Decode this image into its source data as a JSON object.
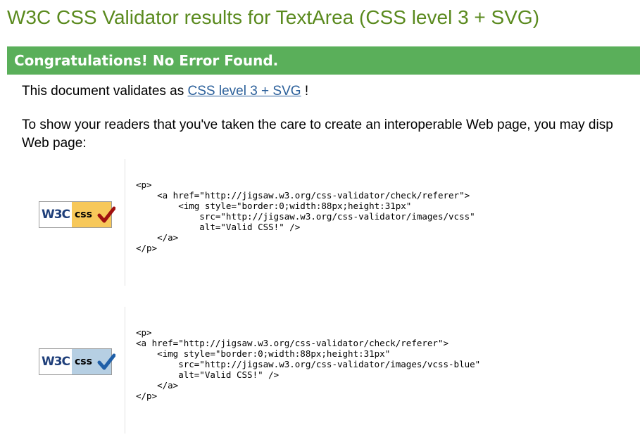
{
  "page": {
    "title": "W3C CSS Validator results for TextArea (CSS level 3 + SVG)"
  },
  "banner": {
    "text": "Congratulations! No Error Found."
  },
  "validates": {
    "prefix": "This document validates as",
    "link_label": "CSS level 3 + SVG",
    "suffix": " !"
  },
  "readers": {
    "text": "To show your readers that you've taken the care to create an interoperable Web page, you may display this icon on any page that validates. Here is the XHTML you could use to add this icon to your Web page:",
    "line1": "To show your readers that you've taken the care to create an interoperable Web page, you may disp",
    "line2": "Web page:"
  },
  "badges": [
    {
      "w3c": "W3C",
      "css": "css",
      "variant": "gold",
      "check_color": "#a01010",
      "code": "<p>\n    <a href=\"http://jigsaw.w3.org/css-validator/check/referer\">\n        <img style=\"border:0;width:88px;height:31px\"\n            src=\"http://jigsaw.w3.org/css-validator/images/vcss\"\n            alt=\"Valid CSS!\" />\n    </a>\n</p>"
    },
    {
      "w3c": "W3C",
      "css": "css",
      "variant": "blue",
      "check_color": "#1f5fa8",
      "code": "<p>\n<a href=\"http://jigsaw.w3.org/css-validator/check/referer\">\n    <img style=\"border:0;width:88px;height:31px\"\n        src=\"http://jigsaw.w3.org/css-validator/images/vcss-blue\"\n        alt=\"Valid CSS!\" />\n    </a>\n</p>"
    }
  ],
  "colors": {
    "title": "#5a8a1e",
    "banner": "#5aaf5a",
    "link": "#2a5f9a"
  }
}
